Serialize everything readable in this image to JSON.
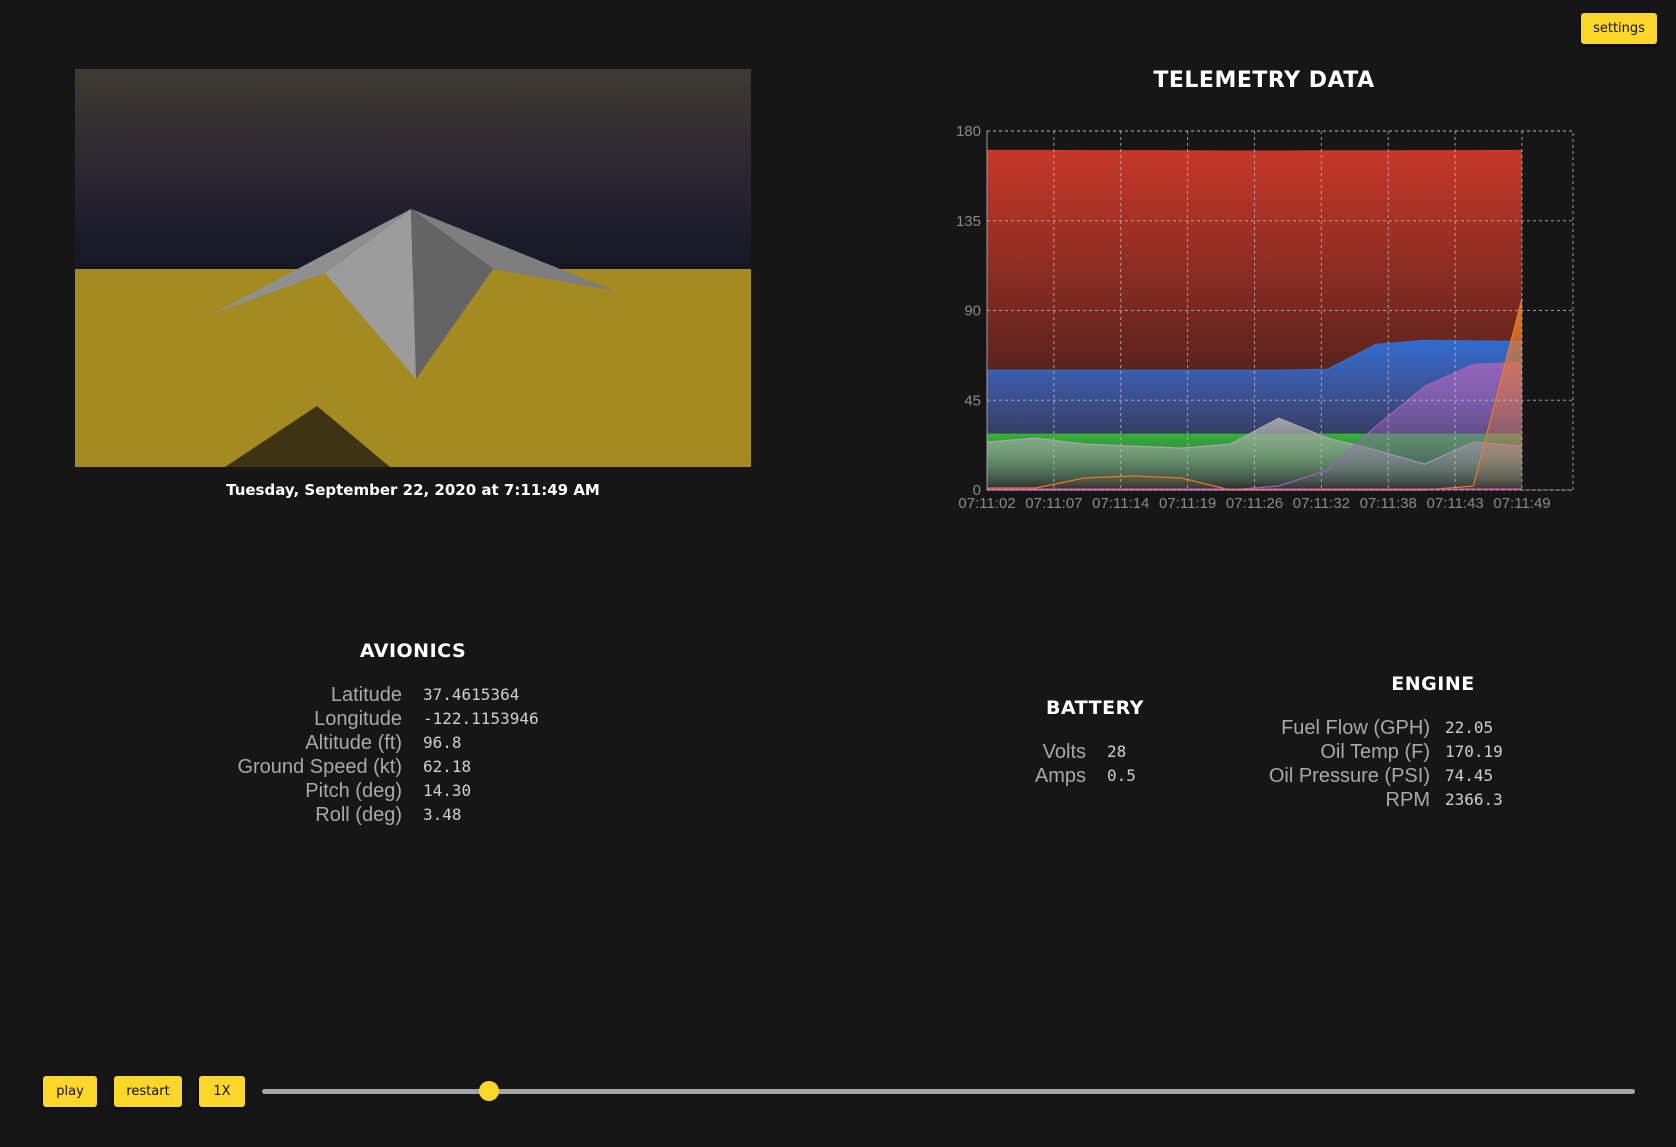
{
  "controls": {
    "settings_label": "settings",
    "play_label": "play",
    "restart_label": "restart",
    "speed_label": "1X",
    "progress": 0.165
  },
  "viewport": {
    "timestamp": "Tuesday, September 22, 2020 at 7:11:49 AM",
    "sky_color": "#3c3832",
    "ground_color": "#a38b21"
  },
  "avionics": {
    "title": "AVIONICS",
    "rows": [
      {
        "label": "Latitude",
        "value": "37.4615364"
      },
      {
        "label": "Longitude",
        "value": "-122.1153946"
      },
      {
        "label": "Altitude (ft)",
        "value": "96.8"
      },
      {
        "label": "Ground Speed (kt)",
        "value": "62.18"
      },
      {
        "label": "Pitch (deg)",
        "value": "14.30"
      },
      {
        "label": "Roll (deg)",
        "value": "3.48"
      }
    ]
  },
  "battery": {
    "title": "BATTERY",
    "rows": [
      {
        "label": "Volts",
        "value": "28"
      },
      {
        "label": "Amps",
        "value": "0.5"
      }
    ]
  },
  "engine": {
    "title": "ENGINE",
    "rows": [
      {
        "label": "Fuel Flow (GPH)",
        "value": "22.05"
      },
      {
        "label": "Oil Temp (F)",
        "value": "170.19"
      },
      {
        "label": "Oil Pressure (PSI)",
        "value": "74.45"
      },
      {
        "label": "RPM",
        "value": "2366.3"
      }
    ]
  },
  "chart_data": {
    "type": "area",
    "title": "TELEMETRY DATA",
    "xlabel": "",
    "ylabel": "",
    "ylim": [
      0,
      180
    ],
    "yticks": [
      0,
      45,
      90,
      135,
      180
    ],
    "xticks": [
      "07:11:02",
      "07:11:07",
      "07:11:14",
      "07:11:19",
      "07:11:26",
      "07:11:32",
      "07:11:38",
      "07:11:43",
      "07:11:49"
    ],
    "grid": true,
    "series": [
      {
        "color": "#d0392a",
        "values": [
          170.2,
          170.2,
          170.1,
          170.1,
          170.0,
          169.9,
          169.9,
          170.0,
          170.0,
          170.1,
          170.1,
          170.2
        ]
      },
      {
        "color": "#2e6fd8",
        "values": [
          60,
          60,
          60,
          60,
          60,
          60,
          60,
          60.5,
          73,
          75,
          74.7,
          74.5
        ]
      },
      {
        "color": "#35b636",
        "values": [
          28,
          28,
          28,
          28,
          28,
          28,
          28,
          28,
          28,
          28,
          28,
          28
        ]
      },
      {
        "color": "#a8a8a8",
        "values": [
          24,
          26,
          23,
          22,
          21,
          23,
          36,
          26,
          20,
          13,
          24,
          22
        ]
      },
      {
        "color": "#9a63b8",
        "values": [
          0,
          0,
          0,
          0,
          0,
          0,
          2,
          10,
          32,
          52,
          63,
          64
        ]
      },
      {
        "color": "#e97a2c",
        "values": [
          1,
          1,
          6,
          7,
          6,
          0,
          0,
          0,
          0,
          0,
          2,
          96
        ]
      },
      {
        "color": "#d14fa0",
        "values": [
          0.5,
          0.5,
          0.5,
          0.5,
          0.5,
          0.5,
          0.5,
          0.5,
          0.5,
          0.5,
          0.5,
          0.5
        ]
      }
    ]
  }
}
